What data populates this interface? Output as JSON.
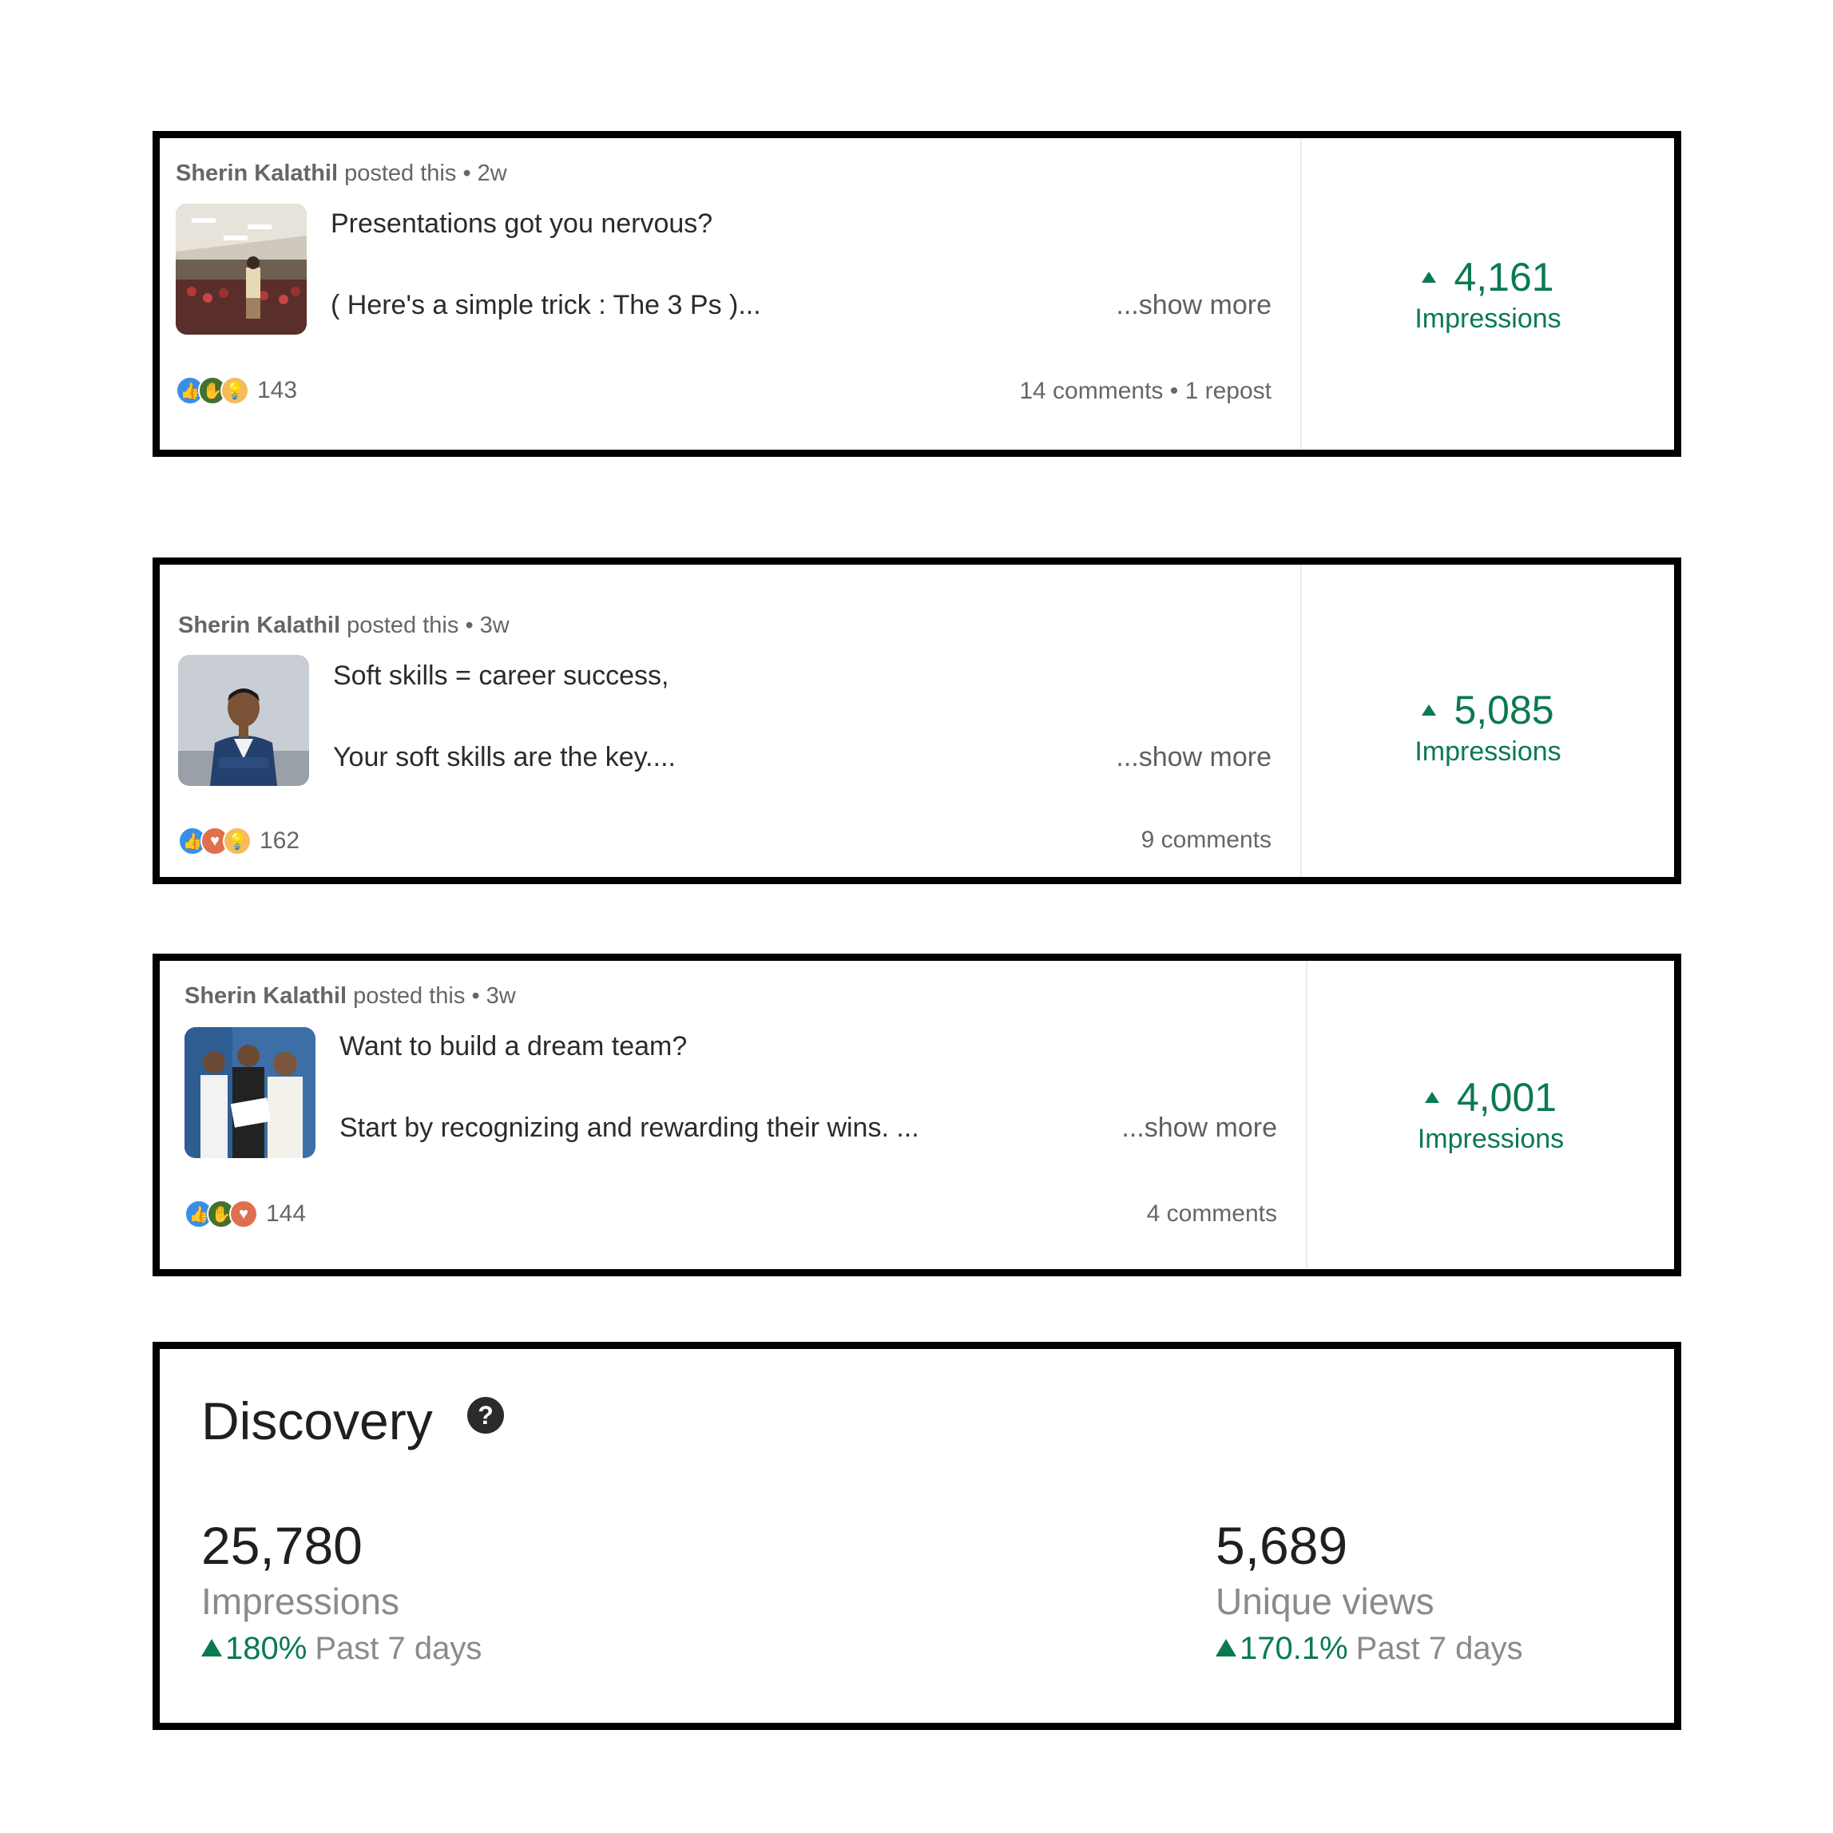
{
  "posts": [
    {
      "author": "Sherin Kalathil",
      "posted_text": "posted this",
      "time": "2w",
      "line1": "Presentations got you nervous?",
      "line2": "( Here's a simple trick : The 3 Ps )...",
      "show_more": "...show more",
      "reaction_count": "143",
      "engagement": "14 comments • 1 repost",
      "impressions_value": "4,161",
      "impressions_label": "Impressions",
      "reactions": [
        "like-icon",
        "celebrate-icon",
        "insightful-icon"
      ]
    },
    {
      "author": "Sherin Kalathil",
      "posted_text": "posted this",
      "time": "3w",
      "line1": "Soft skills = career success,",
      "line2": "Your soft skills are the key....",
      "show_more": "...show more",
      "reaction_count": "162",
      "engagement": "9 comments",
      "impressions_value": "5,085",
      "impressions_label": "Impressions",
      "reactions": [
        "like-icon",
        "love-icon",
        "insightful-icon"
      ]
    },
    {
      "author": "Sherin Kalathil",
      "posted_text": "posted this",
      "time": "3w",
      "line1": "Want to build a dream team?",
      "line2": "Start by recognizing and rewarding their wins. ...",
      "show_more": "...show more",
      "reaction_count": "144",
      "engagement": "4 comments",
      "impressions_value": "4,001",
      "impressions_label": "Impressions",
      "reactions": [
        "like-icon",
        "celebrate-icon",
        "love-icon"
      ]
    }
  ],
  "discovery": {
    "title": "Discovery",
    "help_symbol": "?",
    "impressions": {
      "value": "25,780",
      "label": "Impressions",
      "change": "180%",
      "period": "Past 7 days"
    },
    "unique_views": {
      "value": "5,689",
      "label": "Unique views",
      "change": "170.1%",
      "period": "Past 7 days"
    }
  },
  "colors": {
    "accent_green": "#0b7a4f",
    "border": "#000000"
  }
}
